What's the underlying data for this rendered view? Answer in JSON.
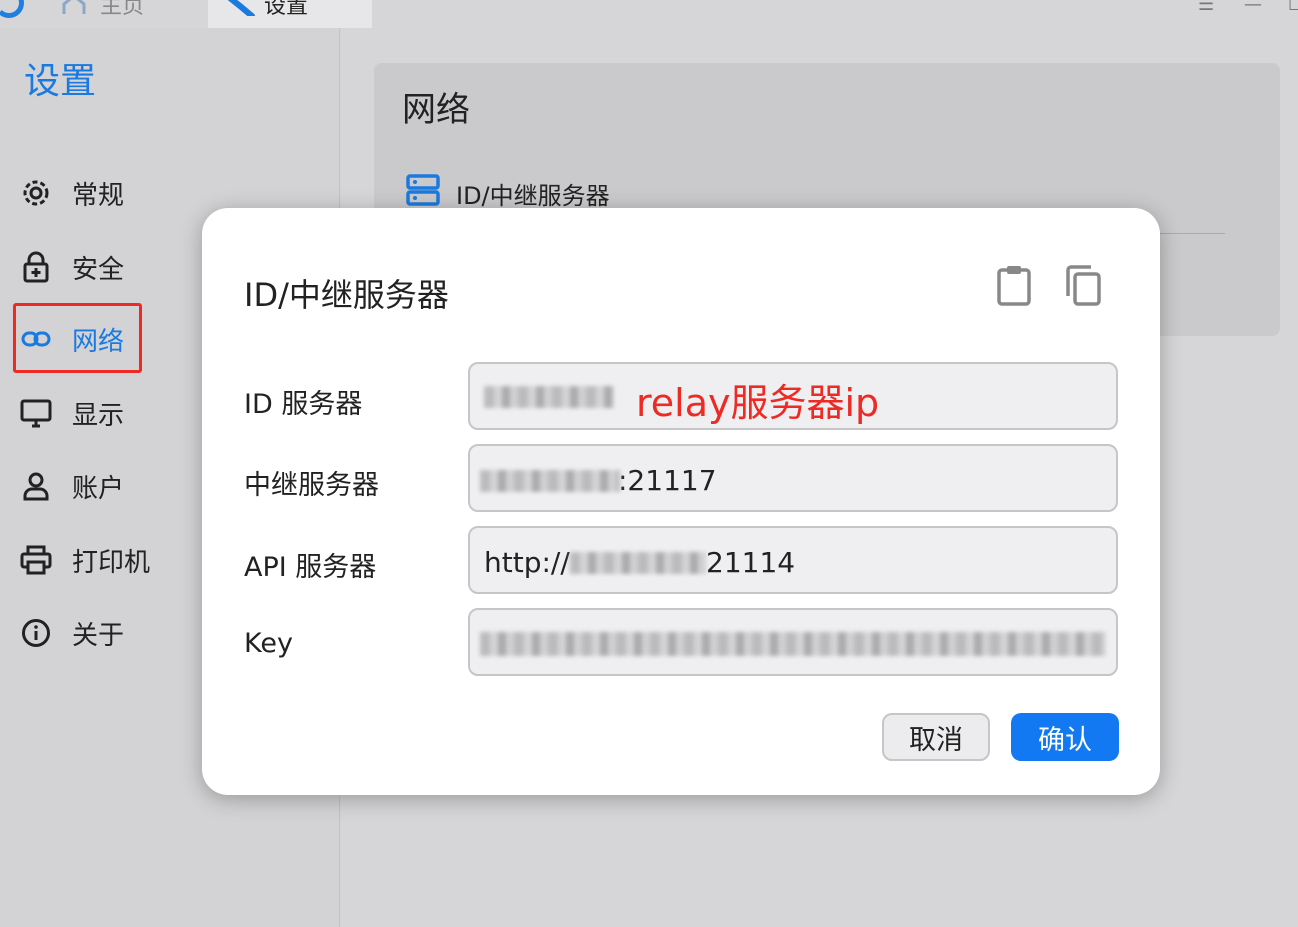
{
  "topbar": {
    "tabs": [
      {
        "label": "主页",
        "icon": "home-icon"
      },
      {
        "label": "设置",
        "icon": "wrench-icon"
      }
    ]
  },
  "sidebar": {
    "title": "设置",
    "items": [
      {
        "label": "常规",
        "icon": "gear-icon"
      },
      {
        "label": "安全",
        "icon": "lock-icon"
      },
      {
        "label": "网络",
        "icon": "link-icon",
        "active": true
      },
      {
        "label": "显示",
        "icon": "monitor-icon"
      },
      {
        "label": "账户",
        "icon": "user-icon"
      },
      {
        "label": "打印机",
        "icon": "printer-icon"
      },
      {
        "label": "关于",
        "icon": "info-icon"
      }
    ]
  },
  "main": {
    "card_title": "网络",
    "row_label": "ID/中继服务器"
  },
  "dialog": {
    "title": "ID/中继服务器",
    "fields": [
      {
        "label": "ID 服务器",
        "value": "",
        "annotation": "relay服务器ip"
      },
      {
        "label": "中继服务器",
        "value": ":21117"
      },
      {
        "label": "API 服务器",
        "value": "http://",
        "value_suffix": "21114"
      },
      {
        "label": "Key",
        "value": ""
      }
    ],
    "cancel_label": "取消",
    "ok_label": "确认"
  },
  "colors": {
    "accent": "#1a7ae0",
    "ok_button": "#1279f2",
    "annotation": "#ee2a24"
  }
}
